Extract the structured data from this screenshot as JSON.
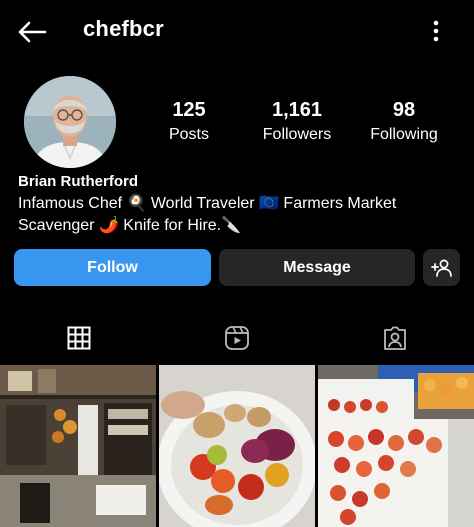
{
  "header": {
    "username": "chefbcr",
    "back_icon": "arrow-left-icon",
    "menu_icon": "more-vertical-icon"
  },
  "profile": {
    "avatar_icon": "profile-photo",
    "stats": [
      {
        "value": "125",
        "label": "Posts"
      },
      {
        "value": "1,161",
        "label": "Followers"
      },
      {
        "value": "98",
        "label": "Following"
      }
    ],
    "name": "Brian Rutherford",
    "bio_line1": "Infamous Chef 🍳 World Traveler 🇪🇺 Farmers Market",
    "bio_line2": "Scavenger 🌶️ Knife for Hire.🔪"
  },
  "actions": {
    "follow_label": "Follow",
    "message_label": "Message",
    "add_user_icon": "add-user-icon"
  },
  "tabs": [
    {
      "icon": "grid-icon",
      "active": true
    },
    {
      "icon": "reels-icon",
      "active": false
    },
    {
      "icon": "tagged-icon",
      "active": false
    }
  ],
  "colors": {
    "background": "#000000",
    "follow_button": "#3797f0",
    "secondary_button": "#262626",
    "text": "#ffffff"
  }
}
